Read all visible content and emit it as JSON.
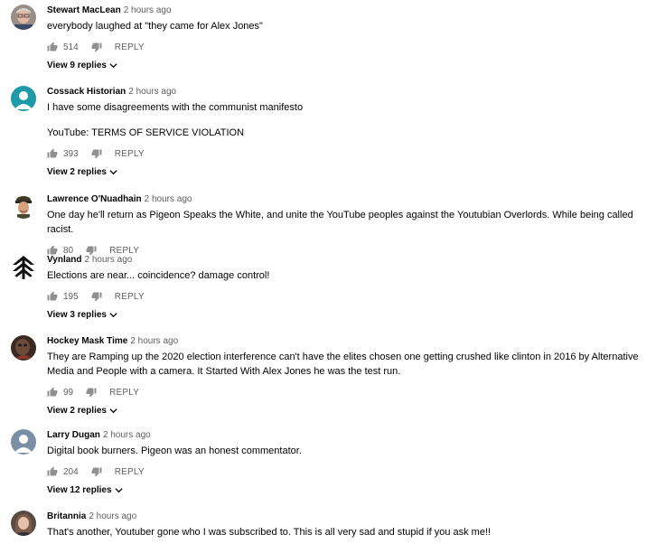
{
  "comments": [
    {
      "author": "Stewart MacLean",
      "time": "2 hours ago",
      "text": [
        "everybody laughed at \"they came for Alex Jones\""
      ],
      "likes": "514",
      "reply": "REPLY",
      "view_replies": "View 9 replies",
      "avatar": "photo-elderly-man"
    },
    {
      "author": "Cossack Historian",
      "time": "2 hours ago",
      "text": [
        "I have some disagreements with the communist manifesto",
        "YouTube: TERMS OF SERVICE VIOLATION"
      ],
      "likes": "393",
      "reply": "REPLY",
      "view_replies": "View 2 replies",
      "avatar": "default-teal-person"
    },
    {
      "author": "Lawrence O'Nuadhain",
      "time": "2 hours ago",
      "text": [
        "One day he'll return as Pigeon Speaks the White, and unite the YouTube peoples against the Youtubian Overlords. While being called racist."
      ],
      "likes": "80",
      "reply": "REPLY",
      "view_replies": "",
      "avatar": "officer-portrait"
    },
    {
      "author": "Vynland",
      "time": "2 hours ago",
      "text": [
        "Elections are near... coincidence? damage control!"
      ],
      "likes": "195",
      "reply": "REPLY",
      "view_replies": "View 3 replies",
      "avatar": "black-chevron-emblem"
    },
    {
      "author": "Hockey Mask Time",
      "time": "2 hours ago",
      "text": [
        "They are Ramping up the 2020 election interference can't have the elites chosen one getting crushed like clinton in 2016 by Alternative Media and People with a camera. It Started With Alex Jones he was the test run."
      ],
      "likes": "99",
      "reply": "REPLY",
      "view_replies": "View 2 replies",
      "avatar": "dark-photo"
    },
    {
      "author": "Larry Dugan",
      "time": "2 hours ago",
      "text": [
        "Digital book burners. Pigeon was an honest commentator."
      ],
      "likes": "204",
      "reply": "REPLY",
      "view_replies": "View 12 replies",
      "avatar": "default-blue-gray-person"
    },
    {
      "author": "Britannia",
      "time": "2 hours ago",
      "text": [
        "That's another, Youtuber gone who I was subscribed to. This is all very sad and stupid if you ask me!!"
      ],
      "likes": "",
      "reply": "",
      "view_replies": "",
      "avatar": "photo-woman"
    }
  ],
  "colors": {
    "teal": "#1e9aa8",
    "bluegray": "#7a8fa6",
    "secondary": "#606060"
  }
}
